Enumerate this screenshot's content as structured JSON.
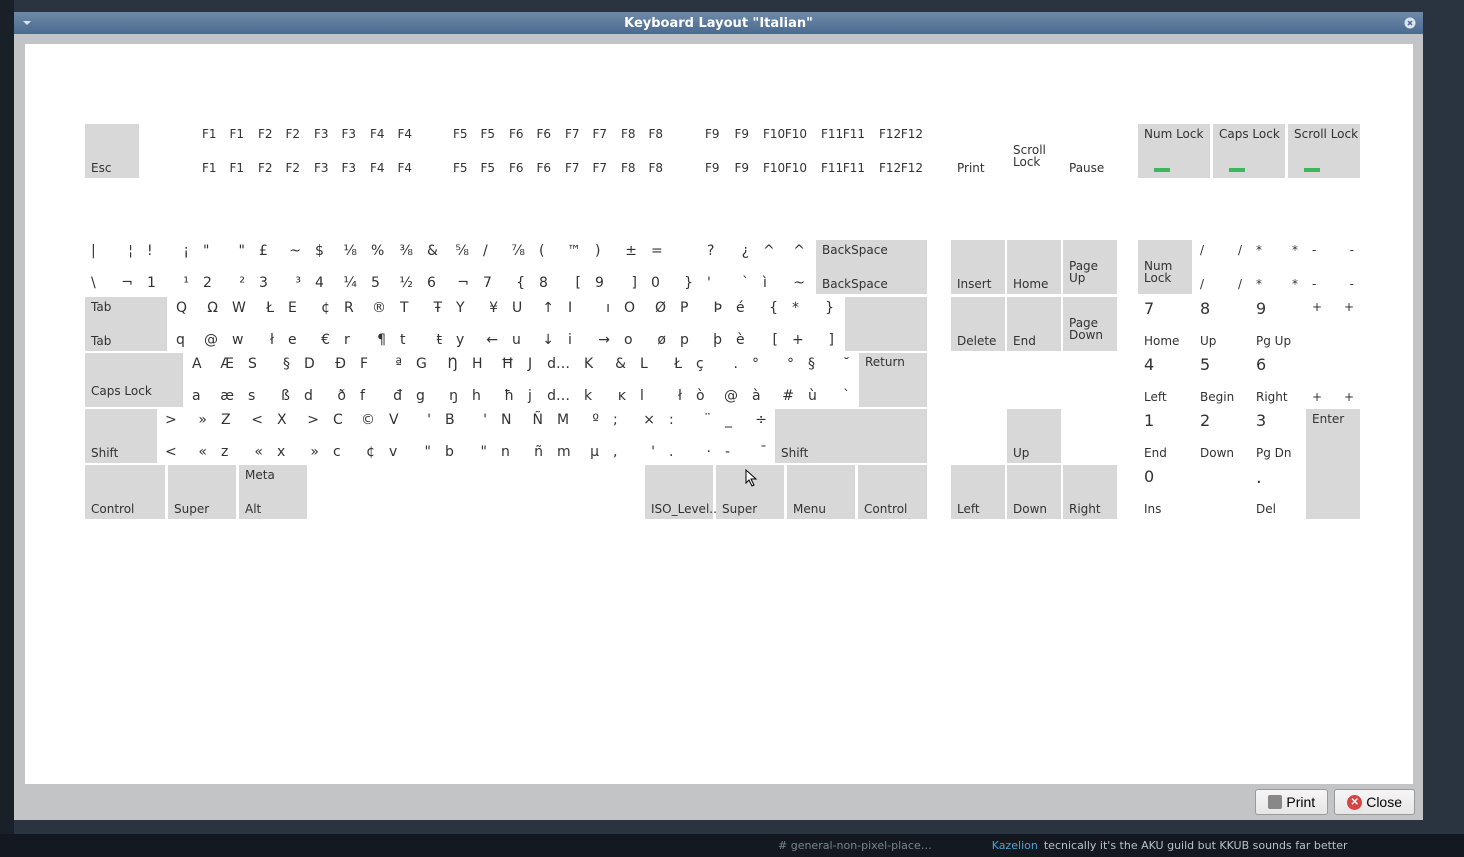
{
  "window": {
    "title": "Keyboard Layout \"Italian\""
  },
  "footer": {
    "print": "Print",
    "close": "Close"
  },
  "keys": {
    "esc": "Esc",
    "f1": {
      "tl": "F1",
      "tr": "F1",
      "bl": "F1",
      "br": "F1"
    },
    "f2": {
      "tl": "F2",
      "tr": "F2",
      "bl": "F2",
      "br": "F2"
    },
    "f3": {
      "tl": "F3",
      "tr": "F3",
      "bl": "F3",
      "br": "F3"
    },
    "f4": {
      "tl": "F4",
      "tr": "F4",
      "bl": "F4",
      "br": "F4"
    },
    "f5": {
      "tl": "F5",
      "tr": "F5",
      "bl": "F5",
      "br": "F5"
    },
    "f6": {
      "tl": "F6",
      "tr": "F6",
      "bl": "F6",
      "br": "F6"
    },
    "f7": {
      "tl": "F7",
      "tr": "F7",
      "bl": "F7",
      "br": "F7"
    },
    "f8": {
      "tl": "F8",
      "tr": "F8",
      "bl": "F8",
      "br": "F8"
    },
    "f9": {
      "tl": "F9",
      "tr": "F9",
      "bl": "F9",
      "br": "F9"
    },
    "f10": {
      "tl": "F10",
      "tr": "F10",
      "bl": "F10",
      "br": "F10"
    },
    "f11": {
      "tl": "F11",
      "tr": "F11",
      "bl": "F11",
      "br": "F11"
    },
    "f12": {
      "tl": "F12",
      "tr": "F12",
      "bl": "F12",
      "br": "F12"
    },
    "print": "Print",
    "scrolllock": "Scroll Lock",
    "pause": "Pause",
    "numlock_ind": "Num Lock",
    "capslock_ind": "Caps Lock",
    "scrolllock_ind": "Scroll Lock",
    "backspace": {
      "top": "BackSpace",
      "bot": "BackSpace"
    },
    "insert": "Insert",
    "home": "Home",
    "pgup": "Page Up",
    "delete": "Delete",
    "end": "End",
    "pgdn": "Page Down",
    "tab": {
      "top": "Tab",
      "bot": "Tab"
    },
    "capslock": "Caps Lock",
    "return": "Return",
    "shift_l": "Shift",
    "shift_r": "Shift",
    "control_l": "Control",
    "super_l": "Super",
    "metaalt": {
      "top": "Meta",
      "bot": "Alt"
    },
    "isolevel": "ISO_Level...",
    "super_r": "Super",
    "menu": "Menu",
    "control_r": "Control",
    "left": "Left",
    "up": "Up",
    "down": "Down",
    "right": "Right",
    "kp_numlock": "Num Lock",
    "kp_enter": "Enter",
    "row1": [
      {
        "tl": "|",
        "tr": "¦",
        "bl": "\\",
        "br": "¬"
      },
      {
        "tl": "!",
        "tr": "¡",
        "bl": "1",
        "br": "¹"
      },
      {
        "tl": "\"",
        "tr": "\"",
        "bl": "2",
        "br": "²"
      },
      {
        "tl": "£",
        "tr": "~",
        "bl": "3",
        "br": "³"
      },
      {
        "tl": "$",
        "tr": "⅛",
        "bl": "4",
        "br": "¼"
      },
      {
        "tl": "%",
        "tr": "⅜",
        "bl": "5",
        "br": "½"
      },
      {
        "tl": "&",
        "tr": "⅝",
        "bl": "6",
        "br": "¬"
      },
      {
        "tl": "/",
        "tr": "⅞",
        "bl": "7",
        "br": "{"
      },
      {
        "tl": "(",
        "tr": "™",
        "bl": "8",
        "br": "["
      },
      {
        "tl": ")",
        "tr": "±",
        "bl": "9",
        "br": "]"
      },
      {
        "tl": "=",
        "tr": "",
        "bl": "0",
        "br": "}"
      },
      {
        "tl": "?",
        "tr": "¿",
        "bl": "'",
        "br": "`"
      },
      {
        "tl": "^",
        "tr": "^",
        "bl": "ì",
        "br": "~"
      }
    ],
    "row2": [
      {
        "tl": "Q",
        "tr": "Ω",
        "bl": "q",
        "br": "@"
      },
      {
        "tl": "W",
        "tr": "Ł",
        "bl": "w",
        "br": "ł"
      },
      {
        "tl": "E",
        "tr": "¢",
        "bl": "e",
        "br": "€"
      },
      {
        "tl": "R",
        "tr": "®",
        "bl": "r",
        "br": "¶"
      },
      {
        "tl": "T",
        "tr": "Ŧ",
        "bl": "t",
        "br": "ŧ"
      },
      {
        "tl": "Y",
        "tr": "¥",
        "bl": "y",
        "br": "←"
      },
      {
        "tl": "U",
        "tr": "↑",
        "bl": "u",
        "br": "↓"
      },
      {
        "tl": "I",
        "tr": "ı",
        "bl": "i",
        "br": "→"
      },
      {
        "tl": "O",
        "tr": "Ø",
        "bl": "o",
        "br": "ø"
      },
      {
        "tl": "P",
        "tr": "Þ",
        "bl": "p",
        "br": "þ"
      },
      {
        "tl": "é",
        "tr": "{",
        "bl": "è",
        "br": "["
      },
      {
        "tl": "*",
        "tr": "}",
        "bl": "+",
        "br": "]"
      }
    ],
    "row3": [
      {
        "tl": "A",
        "tr": "Æ",
        "bl": "a",
        "br": "æ"
      },
      {
        "tl": "S",
        "tr": "§",
        "bl": "s",
        "br": "ß"
      },
      {
        "tl": "D",
        "tr": "Đ",
        "bl": "d",
        "br": "ð"
      },
      {
        "tl": "F",
        "tr": "ª",
        "bl": "f",
        "br": "đ"
      },
      {
        "tl": "G",
        "tr": "Ŋ",
        "bl": "g",
        "br": "ŋ"
      },
      {
        "tl": "H",
        "tr": "Ħ",
        "bl": "h",
        "br": "ħ"
      },
      {
        "tl": "J",
        "tr": "d…",
        "bl": "j",
        "br": "d…"
      },
      {
        "tl": "K",
        "tr": "&",
        "bl": "k",
        "br": "ĸ"
      },
      {
        "tl": "L",
        "tr": "Ł",
        "bl": "l",
        "br": "ł"
      },
      {
        "tl": "ç",
        "tr": ".",
        "bl": "ò",
        "br": "@"
      },
      {
        "tl": "°",
        "tr": "°",
        "bl": "à",
        "br": "#"
      },
      {
        "tl": "§",
        "tr": "˘",
        "bl": "ù",
        "br": "`"
      }
    ],
    "row4": [
      {
        "tl": ">",
        "tr": "»",
        "bl": "<",
        "br": "«"
      },
      {
        "tl": "Z",
        "tr": "<",
        "bl": "z",
        "br": "«"
      },
      {
        "tl": "X",
        "tr": ">",
        "bl": "x",
        "br": "»"
      },
      {
        "tl": "C",
        "tr": "©",
        "bl": "c",
        "br": "¢"
      },
      {
        "tl": "V",
        "tr": "'",
        "bl": "v",
        "br": "\""
      },
      {
        "tl": "B",
        "tr": "'",
        "bl": "b",
        "br": "\""
      },
      {
        "tl": "N",
        "tr": "Ñ",
        "bl": "n",
        "br": "ñ"
      },
      {
        "tl": "M",
        "tr": "º",
        "bl": "m",
        "br": "µ"
      },
      {
        "tl": ";",
        "tr": "×",
        "bl": ",",
        "br": "'"
      },
      {
        "tl": ":",
        "tr": "¨",
        "bl": ".",
        "br": "·"
      },
      {
        "tl": "_",
        "tr": "÷",
        "bl": "-",
        "br": "¯"
      }
    ],
    "kp": {
      "div": {
        "tl": "/",
        "tr": "/",
        "bl": "/",
        "br": "/"
      },
      "mul": {
        "tl": "*",
        "tr": "*",
        "bl": "*",
        "br": "*"
      },
      "sub": {
        "tl": "-",
        "tr": "-",
        "bl": "-",
        "br": "-"
      },
      "add": {
        "tl": "+",
        "tr": "+",
        "bl": "+",
        "br": "+"
      },
      "7": {
        "tl": "7",
        "bl": "Home"
      },
      "8": {
        "tl": "8",
        "bl": "Up"
      },
      "9": {
        "tl": "9",
        "bl": "Pg Up"
      },
      "4": {
        "tl": "4",
        "bl": "Left"
      },
      "5": {
        "tl": "5",
        "bl": "Begin"
      },
      "6": {
        "tl": "6",
        "bl": "Right"
      },
      "1": {
        "tl": "1",
        "bl": "End"
      },
      "2": {
        "tl": "2",
        "bl": "Down"
      },
      "3": {
        "tl": "3",
        "bl": "Pg Dn"
      },
      "0": {
        "tl": "0",
        "bl": "Ins"
      },
      "dot": {
        "tl": ".",
        "bl": "Del"
      }
    }
  },
  "taskbar": {
    "channel": "# general-non-pixel-place…",
    "user": "Kazelion",
    "msg": "tecnically it's the AKU guild but KKUB sounds far better"
  }
}
